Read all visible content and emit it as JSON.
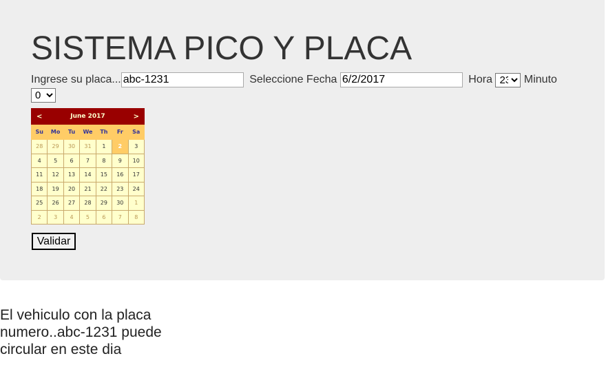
{
  "title": "SISTEMA PICO Y PLACA",
  "form": {
    "plate_label": "Ingrese su placa...",
    "plate_value": "abc-1231",
    "date_label": "Seleccione Fecha",
    "date_value": "6/2/2017",
    "hour_label": "Hora",
    "hour_value": "23",
    "minute_label": "Minuto",
    "minute_value": "0",
    "submit_label": "Validar"
  },
  "calendar": {
    "prev": "<",
    "next": ">",
    "month_title": "June 2017",
    "weekdays": [
      "Su",
      "Mo",
      "Tu",
      "We",
      "Th",
      "Fr",
      "Sa"
    ],
    "selected_day": "2",
    "weeks": [
      [
        "28",
        "29",
        "30",
        "31",
        "1",
        "2",
        "3"
      ],
      [
        "4",
        "5",
        "6",
        "7",
        "8",
        "9",
        "10"
      ],
      [
        "11",
        "12",
        "13",
        "14",
        "15",
        "16",
        "17"
      ],
      [
        "18",
        "19",
        "20",
        "21",
        "22",
        "23",
        "24"
      ],
      [
        "25",
        "26",
        "27",
        "28",
        "29",
        "30",
        "1"
      ],
      [
        "2",
        "3",
        "4",
        "5",
        "6",
        "7",
        "8"
      ]
    ]
  },
  "result_text": "El vehiculo con la placa numero..abc-1231 puede circular en este dia"
}
